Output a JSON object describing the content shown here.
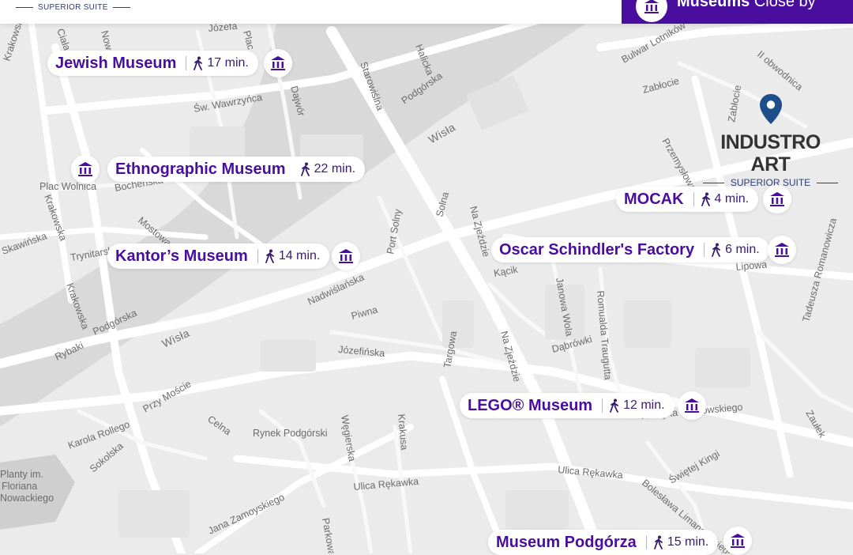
{
  "topbar": {
    "brand_subtitle": "SUPERIOR SUITE",
    "tab_bold": "Museums",
    "tab_light": "Close by",
    "tab_icon": "museum-icon"
  },
  "hotel": {
    "name": "INDUSTRO ART",
    "subtitle": "SUPERIOR SUITE",
    "pin_color": "#1f4e8c",
    "icon": "map-pin-icon"
  },
  "museums": [
    {
      "name": "Jewish Museum",
      "time": "17 min."
    },
    {
      "name": "Ethnographic Museum",
      "time": "22 min."
    },
    {
      "name": "Kantor’s Museum",
      "time": "14 min."
    },
    {
      "name": "MOCAK",
      "time": "4 min."
    },
    {
      "name": "Oscar Schindler's Factory",
      "time": "6 min."
    },
    {
      "name": "LEGO® Museum",
      "time": "12 min."
    },
    {
      "name": "Museum Podgórza",
      "time": "15 min."
    }
  ],
  "streets": [
    "Krakowska",
    "Józefa",
    "Ciała",
    "Nowa",
    "Plac",
    "Bulwar Lotników",
    "II obwodnica",
    "Zabłocie",
    "Zabłocie",
    "Starowiślna",
    "Halicka",
    "Podgórska",
    "Św. Wawrzyńca",
    "Dajwór",
    "Wisła",
    "Przemysłowa",
    "Plac Wolnica",
    "Bocheńska",
    "Krakowska",
    "Skawińska",
    "Mostowa",
    "Trynitarska",
    "Port Solny",
    "Solna",
    "Na Zjeździe",
    "Krakowska",
    "Nadwiślańska",
    "Kącik",
    "Janowa Wola",
    "Romualda Traugutta",
    "Lipowa",
    "Tadeusza Romanowicza",
    "Podgórska",
    "Rybaki",
    "Wisła",
    "Piwna",
    "Józefińska",
    "Targowa",
    "Na Zjeździe",
    "Dąbrówki",
    "Przy Moście",
    "Henryka Dąbrowskiego",
    "Zaułek",
    "Karola Rollego",
    "Sokolska",
    "Celna",
    "Rynek Podgórski",
    "Węgierska",
    "Krakusa",
    "Planty im.",
    "Floriana",
    "Nowackiego",
    "Ulica Rękawka",
    "Ulica Rękawka",
    "Świętej Kingi",
    "Bolesława Limanowskiego",
    "Jana Zamoyskiego",
    "Parkowa"
  ],
  "colors": {
    "accent": "#4a0e9e",
    "map_bg": "#ececec",
    "road": "#ffffff",
    "river": "#dadada"
  }
}
